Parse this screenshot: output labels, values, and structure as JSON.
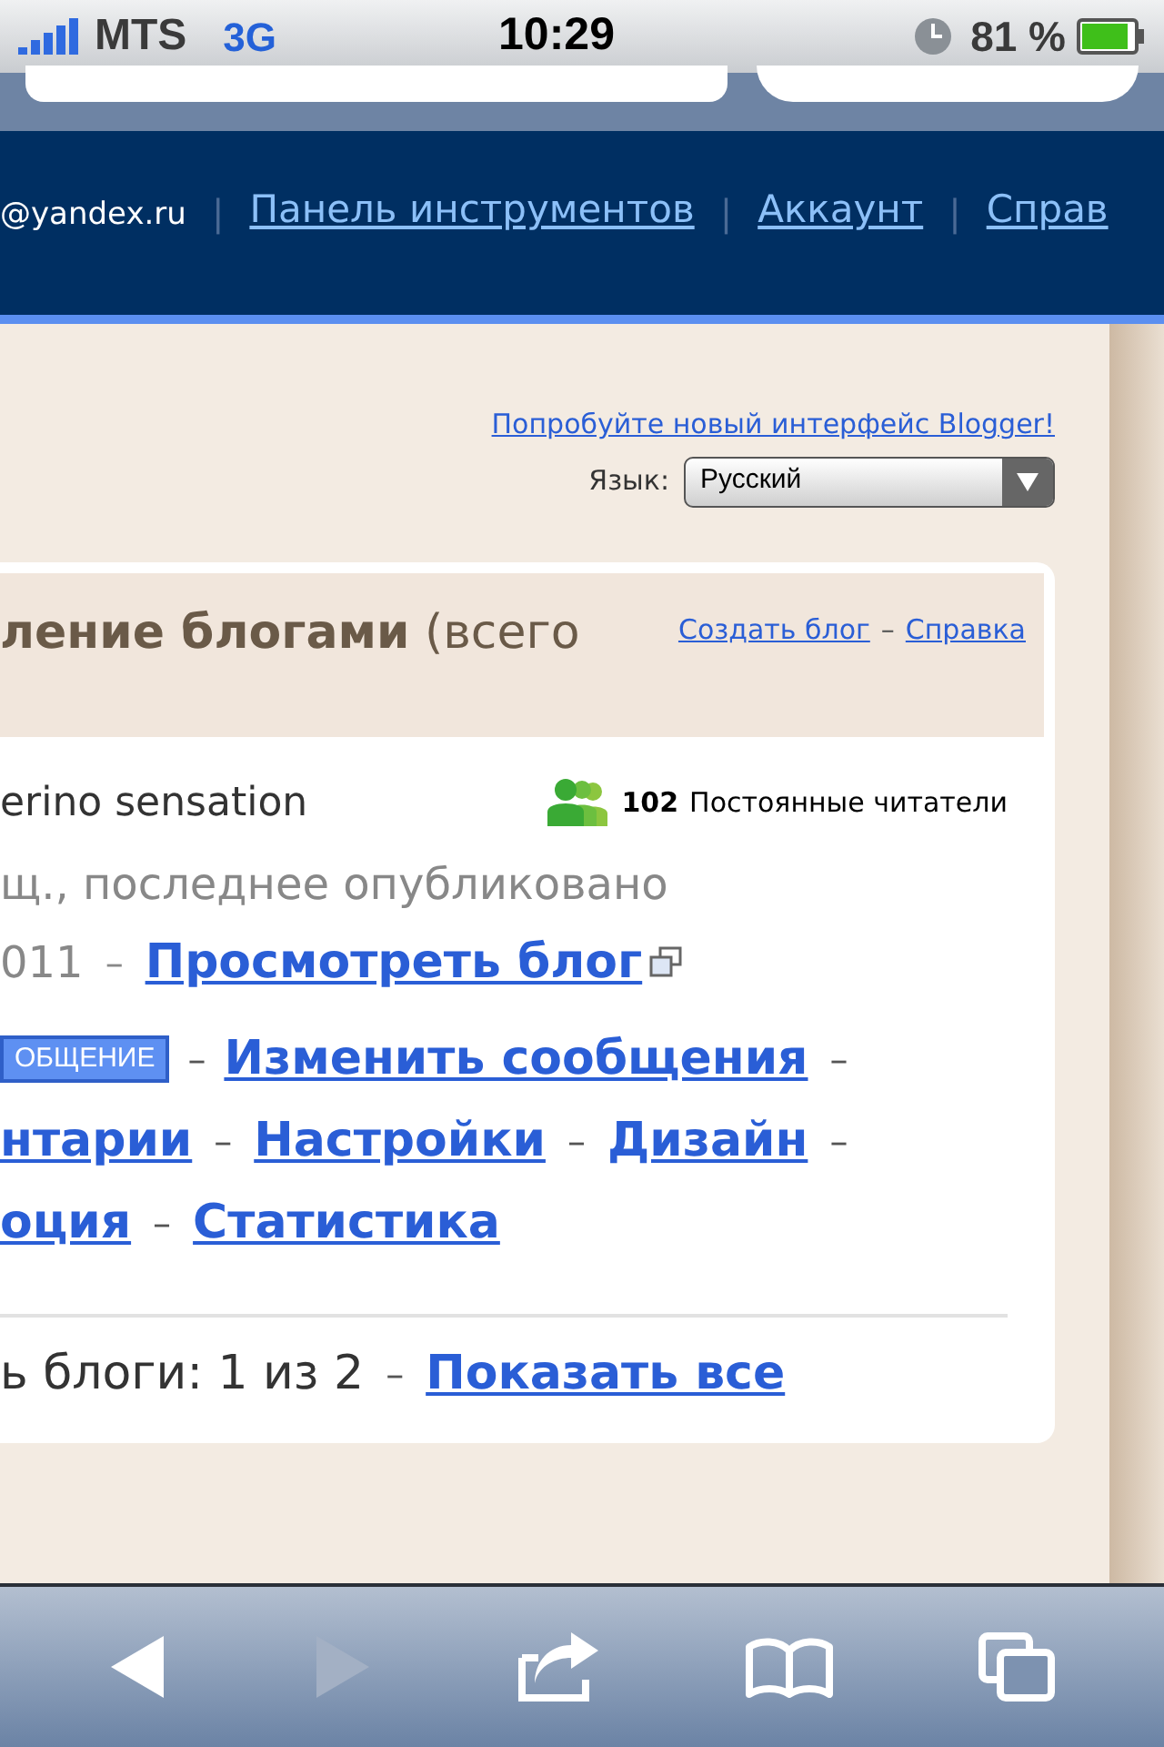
{
  "status_bar": {
    "carrier": "MTS",
    "network": "3G",
    "time": "10:29",
    "battery": "81 %"
  },
  "nav": {
    "account": "@yandex.ru",
    "separator": "|",
    "links": [
      "Панель инструментов",
      "Аккаунт",
      "Справ"
    ]
  },
  "top": {
    "promo_link": "Попробуйте новый интерфейс Blogger!",
    "language_label": "Язык:",
    "language_value": "Русский"
  },
  "panel": {
    "title": "**ление блогами** (всего",
    "separator": "–",
    "links": [
      "Создать блог",
      "Справка"
    ],
    "blog": {
      "name": "erino sensation",
      "followers_count": "102",
      "followers_label": "Постоянные читатели",
      "info_line": "щ., последнее опубликовано",
      "date": "011",
      "view_link": "Просмотреть блог",
      "new_post_button": "ОБЩЕНИЕ",
      "action_rows": [
        [
          "Изменить сообщения"
        ],
        [
          "нтарии",
          "Настройки",
          "Дизайн"
        ],
        [
          "оция",
          "Статистика"
        ]
      ]
    },
    "footer_text": "ь блоги: 1 из 2",
    "footer_link": "Показать все"
  },
  "toolbar": [
    {
      "kind": "back",
      "disabled": false
    },
    {
      "kind": "forward",
      "disabled": true
    },
    {
      "kind": "share",
      "disabled": false
    },
    {
      "kind": "bookmarks",
      "disabled": false
    },
    {
      "kind": "tabs",
      "disabled": false
    }
  ]
}
